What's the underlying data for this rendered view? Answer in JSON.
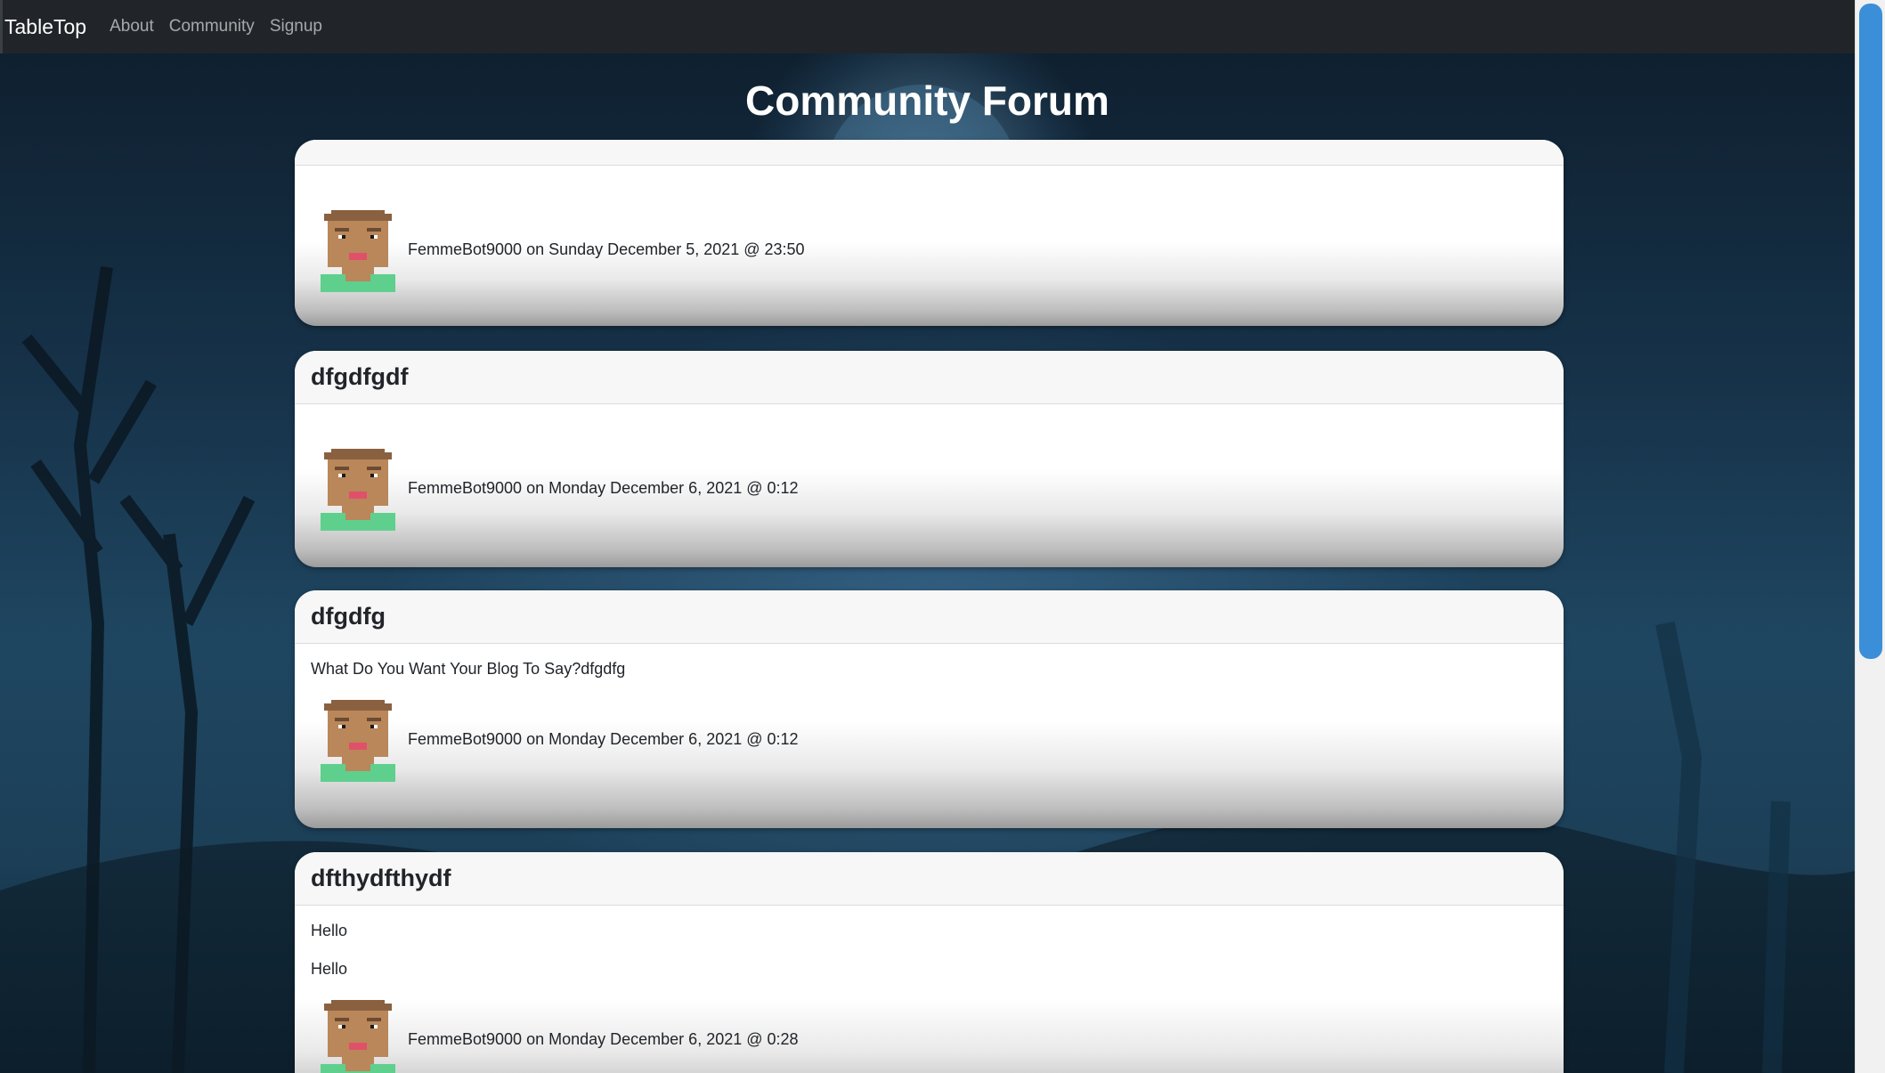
{
  "nav": {
    "brand": "TableTop",
    "links": [
      "About",
      "Community",
      "Signup"
    ]
  },
  "page_title": "Community Forum",
  "posts": [
    {
      "title": "",
      "paragraphs": [],
      "author": "FemmeBot9000",
      "on": "on",
      "date": "Sunday December 5, 2021 @ 23:50"
    },
    {
      "title": "dfgdfgdf",
      "paragraphs": [],
      "author": "FemmeBot9000",
      "on": "on",
      "date": "Monday December 6, 2021 @ 0:12"
    },
    {
      "title": "dfgdfg",
      "paragraphs": [
        "What Do You Want Your Blog To Say?dfgdfg"
      ],
      "author": "FemmeBot9000",
      "on": "on",
      "date": "Monday December 6, 2021 @ 0:12"
    },
    {
      "title": "dfthydfthydf",
      "paragraphs": [
        "Hello",
        "Hello"
      ],
      "author": "FemmeBot9000",
      "on": "on",
      "date": "Monday December 6, 2021 @ 0:28"
    }
  ],
  "colors": {
    "navbar": "#212529",
    "scroll_thumb": "#3b8fd9",
    "avatar_skin": "#b9875a",
    "avatar_shirt": "#5fcf8d",
    "avatar_lips": "#e0506a"
  }
}
